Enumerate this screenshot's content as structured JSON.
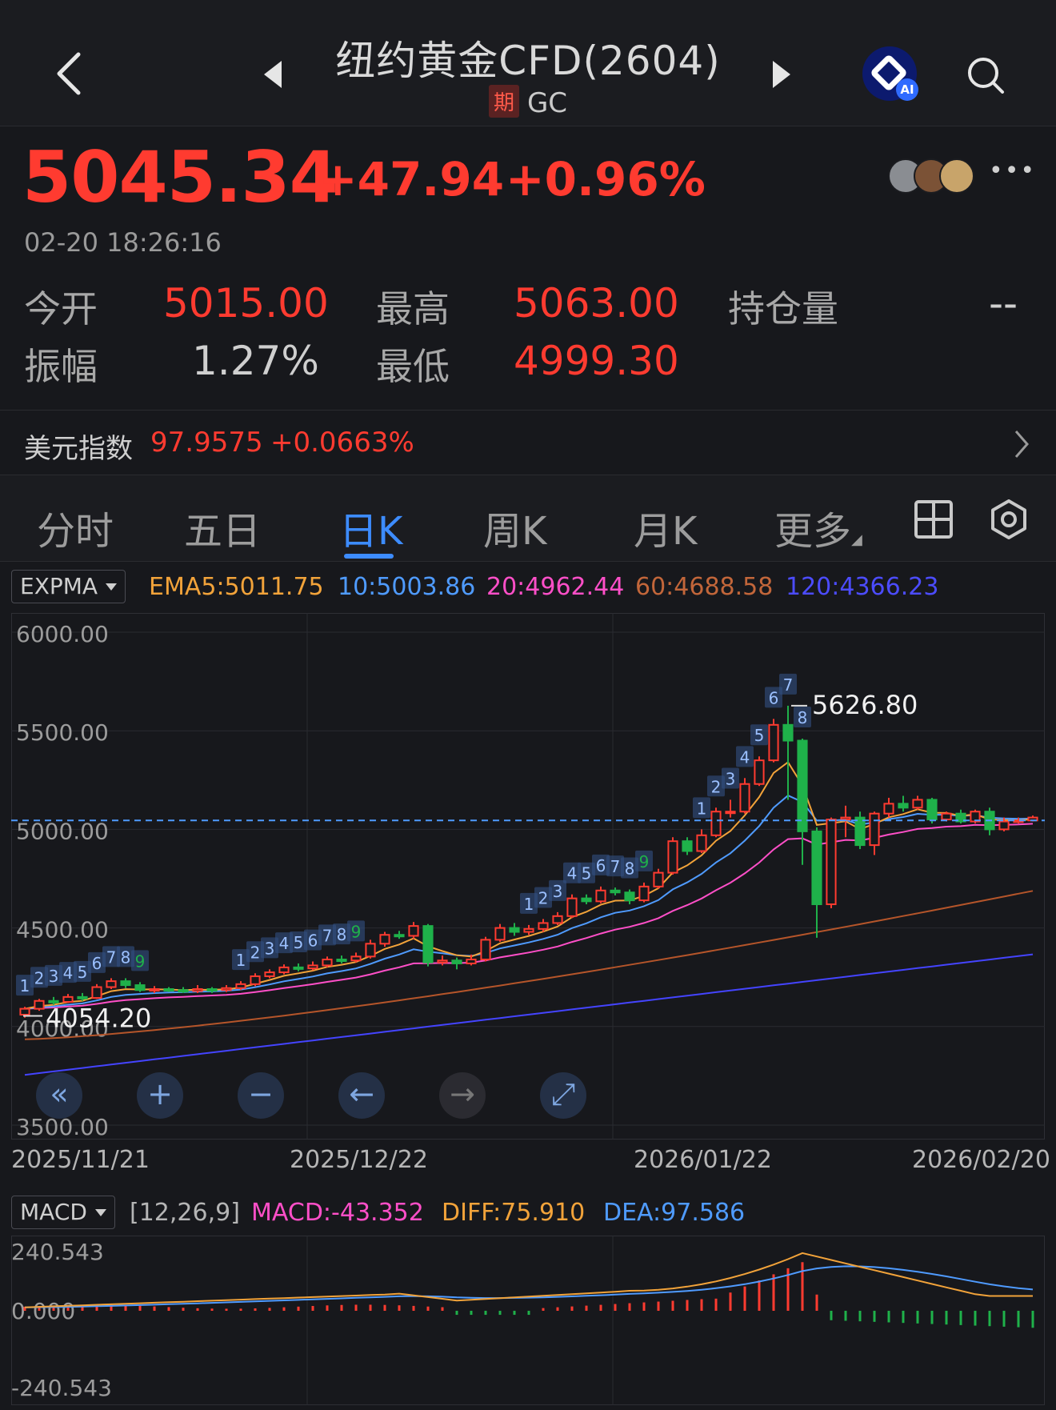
{
  "header": {
    "title": "纽约黄金CFD(2604)",
    "tag": "期",
    "code": "GC"
  },
  "quote": {
    "price": "5045.34",
    "change": "+47.94",
    "change_pct": "+0.96%",
    "time": "02-20 18:26:16",
    "open_label": "今开",
    "open": "5015.00",
    "high_label": "最高",
    "high": "5063.00",
    "oi_label": "持仓量",
    "oi": "--",
    "amp_label": "振幅",
    "amp": "1.27%",
    "low_label": "最低",
    "low": "4999.30"
  },
  "usd_index": {
    "label": "美元指数",
    "value": "97.9575",
    "change": "+0.0663%"
  },
  "tabs": [
    "分时",
    "五日",
    "日K",
    "周K",
    "月K",
    "更多"
  ],
  "active_tab": "日K",
  "ema": {
    "indicator": "EXPMA",
    "ema5": "EMA5:5011.75",
    "ema10": "10:5003.86",
    "ema20": "20:4962.44",
    "ema60": "60:4688.58",
    "ema120": "120:4366.23"
  },
  "macd": {
    "indicator": "MACD",
    "params": "[12,26,9]",
    "macd": "MACD:-43.352",
    "diff": "DIFF:75.910",
    "dea": "DEA:97.586"
  },
  "colors": {
    "up": "#ff3b30",
    "down": "#1fb14a",
    "ema5": "#f2a33a",
    "ema10": "#4f9bff",
    "ema20": "#ff4fc8",
    "ema60": "#b5552a",
    "ema120": "#4444ff",
    "accent": "#3d8cff"
  },
  "chart_data": {
    "type": "candlestick",
    "y_axis_labels": [
      "6000.00",
      "5500.00",
      "5000.00",
      "4500.00",
      "4000.00",
      "3500.00"
    ],
    "ylim": [
      3500,
      6000
    ],
    "x_axis_labels": [
      "2025/11/21",
      "2025/12/22",
      "2026/01/22",
      "2026/02/20"
    ],
    "max_label": "5626.80",
    "min_label": "4054.20",
    "last_price_line": 5045.34,
    "candles": [
      [
        4060,
        4090,
        4045,
        4100
      ],
      [
        4090,
        4130,
        4080,
        4140
      ],
      [
        4130,
        4125,
        4110,
        4150
      ],
      [
        4125,
        4150,
        4120,
        4165
      ],
      [
        4150,
        4145,
        4130,
        4170
      ],
      [
        4145,
        4200,
        4140,
        4215
      ],
      [
        4200,
        4230,
        4190,
        4245
      ],
      [
        4230,
        4210,
        4195,
        4245
      ],
      [
        4210,
        4185,
        4175,
        4225
      ],
      [
        4185,
        4190,
        4170,
        4205
      ],
      [
        4190,
        4185,
        4175,
        4200
      ],
      [
        4185,
        4180,
        4170,
        4200
      ],
      [
        4180,
        4190,
        4170,
        4210
      ],
      [
        4190,
        4185,
        4170,
        4200
      ],
      [
        4185,
        4195,
        4175,
        4210
      ],
      [
        4195,
        4215,
        4185,
        4230
      ],
      [
        4215,
        4255,
        4205,
        4270
      ],
      [
        4255,
        4275,
        4245,
        4290
      ],
      [
        4275,
        4300,
        4265,
        4315
      ],
      [
        4300,
        4295,
        4280,
        4320
      ],
      [
        4295,
        4310,
        4285,
        4330
      ],
      [
        4310,
        4340,
        4300,
        4355
      ],
      [
        4340,
        4335,
        4320,
        4360
      ],
      [
        4335,
        4355,
        4325,
        4375
      ],
      [
        4355,
        4420,
        4345,
        4440
      ],
      [
        4420,
        4465,
        4405,
        4480
      ],
      [
        4465,
        4460,
        4445,
        4485
      ],
      [
        4460,
        4510,
        4445,
        4530
      ],
      [
        4510,
        4325,
        4305,
        4520
      ],
      [
        4325,
        4335,
        4310,
        4360
      ],
      [
        4335,
        4320,
        4290,
        4350
      ],
      [
        4320,
        4340,
        4310,
        4365
      ],
      [
        4340,
        4440,
        4330,
        4455
      ],
      [
        4440,
        4500,
        4430,
        4520
      ],
      [
        4500,
        4480,
        4460,
        4525
      ],
      [
        4480,
        4495,
        4465,
        4515
      ],
      [
        4495,
        4525,
        4480,
        4545
      ],
      [
        4525,
        4560,
        4515,
        4580
      ],
      [
        4560,
        4650,
        4550,
        4670
      ],
      [
        4650,
        4635,
        4620,
        4670
      ],
      [
        4635,
        4690,
        4625,
        4710
      ],
      [
        4690,
        4680,
        4665,
        4705
      ],
      [
        4680,
        4640,
        4620,
        4695
      ],
      [
        4640,
        4710,
        4630,
        4730
      ],
      [
        4710,
        4780,
        4700,
        4800
      ],
      [
        4780,
        4940,
        4770,
        4960
      ],
      [
        4940,
        4890,
        4870,
        4960
      ],
      [
        4890,
        4970,
        4880,
        5000
      ],
      [
        4970,
        5090,
        4960,
        5110
      ],
      [
        5090,
        5090,
        5060,
        5150
      ],
      [
        5090,
        5230,
        5080,
        5260
      ],
      [
        5230,
        5350,
        5220,
        5370
      ],
      [
        5350,
        5530,
        5340,
        5560
      ],
      [
        5530,
        5450,
        5150,
        5627
      ],
      [
        5450,
        4990,
        4820,
        5460
      ],
      [
        4990,
        4620,
        4450,
        5010
      ],
      [
        4620,
        5050,
        4600,
        5060
      ],
      [
        5050,
        5060,
        4960,
        5120
      ],
      [
        5060,
        4920,
        4900,
        5090
      ],
      [
        4920,
        5080,
        4870,
        5090
      ],
      [
        5080,
        5130,
        5060,
        5160
      ],
      [
        5130,
        5110,
        5090,
        5170
      ],
      [
        5110,
        5150,
        5100,
        5170
      ],
      [
        5150,
        5050,
        5030,
        5160
      ],
      [
        5050,
        5080,
        5040,
        5090
      ],
      [
        5080,
        5040,
        5030,
        5100
      ],
      [
        5040,
        5090,
        5030,
        5100
      ],
      [
        5090,
        5000,
        4970,
        5110
      ],
      [
        5000,
        5040,
        4990,
        5060
      ],
      [
        5040,
        5045,
        5030,
        5060
      ],
      [
        5045,
        5060,
        5040,
        5070
      ]
    ],
    "macd_axis_labels": [
      "240.543",
      "0.000",
      "-240.543"
    ]
  }
}
